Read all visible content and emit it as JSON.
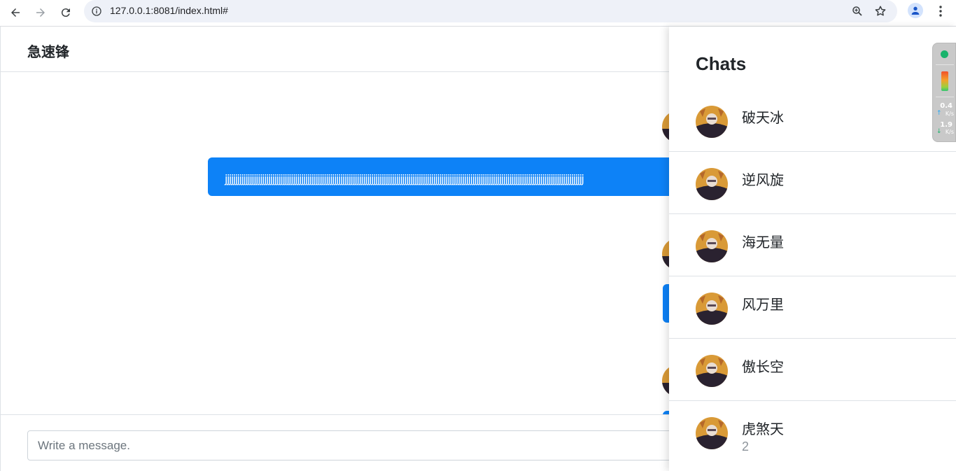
{
  "browser": {
    "url": "127.0.0.1:8081/index.html#",
    "icons": [
      "back-arrow-icon",
      "forward-arrow-icon",
      "reload-icon",
      "site-info-icon",
      "zoom-icon",
      "bookmark-star-icon",
      "profile-icon",
      "more-menu-icon"
    ]
  },
  "app": {
    "title": "急速锋",
    "message_text": "jjjjjjjjjjjjjjjjjjjjjjjjjjjjjjjjjjjjjjjjjjjjjjjjjjjjjjjjjjjjjjjjjjjjjjjjjjjjjjjjjjjjjjjjjjjjjjjjjjjjjjjjjjjjjjjjjjjjjjjjjjjjjjjjjjjjjjjjjjjjjjjjjjjjjjjjjjjjjjjjjjjjjjjjjjjjjj",
    "composer": {
      "placeholder": "Write a message."
    },
    "accent_color": "#0d82f7"
  },
  "chats": {
    "title": "Chats",
    "items": [
      {
        "name": "破天冰",
        "count": ""
      },
      {
        "name": "逆风旋",
        "count": ""
      },
      {
        "name": "海无量",
        "count": ""
      },
      {
        "name": "风万里",
        "count": ""
      },
      {
        "name": "傲长空",
        "count": ""
      },
      {
        "name": "虎煞天",
        "count": "2"
      }
    ]
  },
  "net_widget": {
    "status_color": "#19b36b",
    "upload": {
      "value": "0.4",
      "unit": "K/s"
    },
    "download": {
      "value": "1.9",
      "unit": "K/s"
    }
  }
}
